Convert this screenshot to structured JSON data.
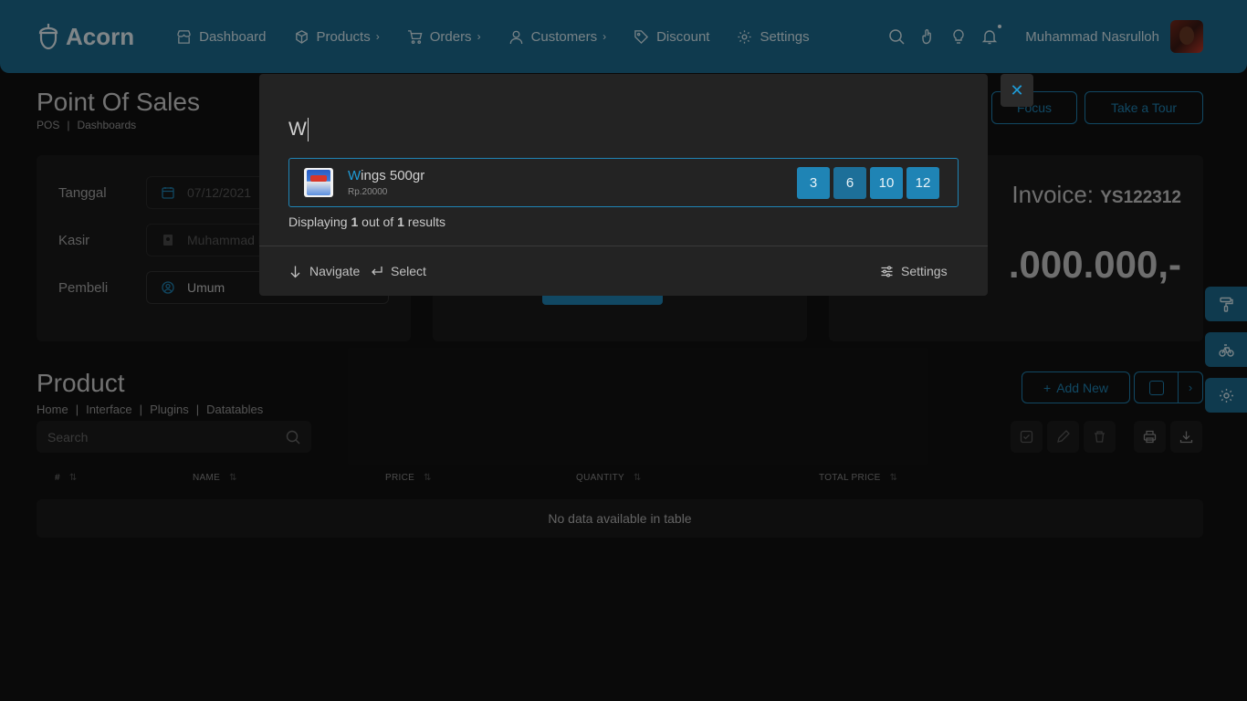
{
  "brand": {
    "name": "Acorn"
  },
  "nav": {
    "items": [
      {
        "label": "Dashboard",
        "icon": "store-icon",
        "has_chevron": false
      },
      {
        "label": "Products",
        "icon": "box-icon",
        "has_chevron": true
      },
      {
        "label": "Orders",
        "icon": "cart-icon",
        "has_chevron": true
      },
      {
        "label": "Customers",
        "icon": "user-icon",
        "has_chevron": true
      },
      {
        "label": "Discount",
        "icon": "tag-icon",
        "has_chevron": false
      },
      {
        "label": "Settings",
        "icon": "gear-icon",
        "has_chevron": false
      }
    ],
    "user_name": "Muhammad Nasrulloh",
    "chevron": "›"
  },
  "page": {
    "title": "Point Of Sales",
    "breadcrumb": [
      "POS",
      "Dashboards"
    ],
    "focus_label": "Focus",
    "tour_label": "Take a Tour"
  },
  "form": {
    "tanggal_label": "Tanggal",
    "tanggal_value": "07/12/2021",
    "kasir_label": "Kasir",
    "kasir_value": "Muhammad N",
    "pembeli_label": "Pembeli",
    "pembeli_value": "Umum"
  },
  "invoice": {
    "label": "Invoice:",
    "number": "YS122312",
    "total": ".000.000,-"
  },
  "product": {
    "title": "Product",
    "breadcrumb": [
      "Home",
      "Interface",
      "Plugins",
      "Datatables"
    ],
    "add_label": "Add New",
    "search_placeholder": "Search",
    "columns": [
      "#",
      "NAME",
      "PRICE",
      "QUANTITY",
      "TOTAL PRICE"
    ],
    "sort_glyph": "⇅",
    "empty_text": "No data available in table"
  },
  "modal": {
    "query": "W",
    "result": {
      "highlight": "W",
      "rest": "ings 500gr",
      "price": "Rp.20000",
      "quantities": [
        "3",
        "6",
        "10",
        "12"
      ]
    },
    "count_prefix": "Displaying",
    "count_shown": "1",
    "count_mid": "out of",
    "count_total": "1",
    "count_suffix": "results",
    "navigate_label": "Navigate",
    "select_label": "Select",
    "settings_label": "Settings",
    "close_glyph": "✕"
  },
  "colors": {
    "nav_bg": "#1c6b8f",
    "accent": "#1f84b5",
    "background": "#121212"
  }
}
